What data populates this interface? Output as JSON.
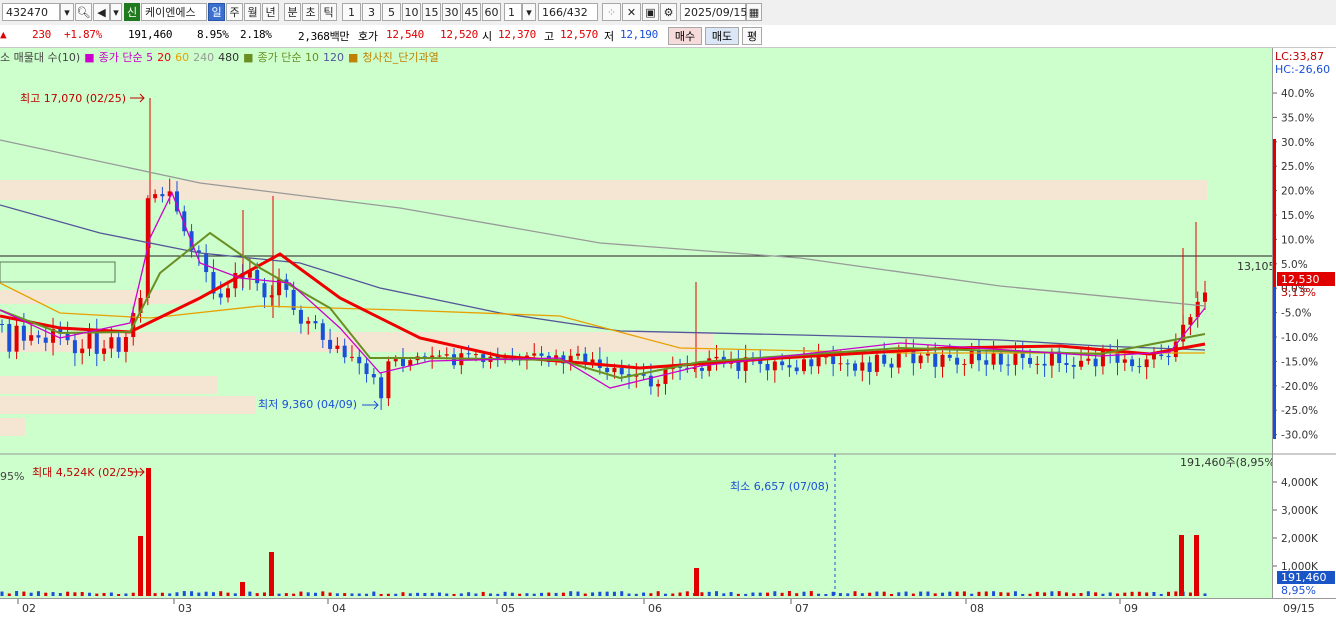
{
  "toolbar": {
    "code": "432470",
    "credit_badge": "신",
    "stock_name": "케이엔에스",
    "periods": [
      "일",
      "주",
      "월",
      "년",
      "분",
      "초",
      "틱"
    ],
    "selected_period": "일",
    "minute_values": [
      "1",
      "3",
      "5",
      "10",
      "15",
      "30",
      "45",
      "60"
    ],
    "count_value": "1",
    "bars_shown": "166",
    "bars_total": "/432",
    "date": "2025/09/15"
  },
  "infobar": {
    "change_arrow": "▲",
    "change": "230",
    "change_pct": "+1.87%",
    "volume": "191,460",
    "volume_pct": "8.95%",
    "turnover_pct": "2.18%",
    "amount": "2,368백만",
    "quote_label": "호가",
    "ask": "12,540",
    "bid": "12,520",
    "open_label": "시",
    "open": "12,370",
    "high_label": "고",
    "high": "12,570",
    "low_label": "저",
    "low": "12,190",
    "buy_label": "매수",
    "sell_label": "매도",
    "avg_label": "평"
  },
  "legend": {
    "item1": "소 매물대 수(10)",
    "item2": "종가 단순 5",
    "item2_vals": [
      "20",
      "60",
      "240",
      "480"
    ],
    "item3": "종가 단순 10",
    "item3_vals": [
      "120"
    ],
    "item4": "청사진_단기과열"
  },
  "annotations": {
    "high_label": "최고 17,070 (02/25)",
    "low_label": "최저 9,360 (04/09)",
    "vol_max_label": "최대 4,524K (02/25)",
    "vol_min_label": "최소 6,657 (07/08)",
    "vol_max_prefix": "95%",
    "ref_price": "13,105",
    "vol_summary": "191,460주(8,95%)",
    "lc": "LC:33,87",
    "hc": "HC:-26,60"
  },
  "price_tag": {
    "price": "12,530",
    "pct": "3,13%",
    "vol": "191,460",
    "vol_pct": "8,95%"
  },
  "right_axis": {
    "pct_labels": [
      "40.0%",
      "35.0%",
      "30.0%",
      "25.0%",
      "20.0%",
      "15.0%",
      "10.0%",
      "5.0%",
      "0.0%",
      "-5.0%",
      "-10.0%",
      "-15.0%",
      "-20.0%",
      "-25.0%",
      "-30.0%"
    ],
    "vol_labels": [
      "4,000K",
      "3,000K",
      "2,000K",
      "1,000K"
    ]
  },
  "x_axis": {
    "months": [
      "02",
      "03",
      "04",
      "05",
      "06",
      "07",
      "08",
      "09"
    ],
    "end_date": "09/15"
  },
  "colors": {
    "chart_bg": "#ccffcc",
    "up": "#e00000",
    "down": "#1a4fd8",
    "ma5": "#cc00cc",
    "ma20": "#ee0000",
    "ma60": "#ffa500",
    "ma120": "#555599",
    "ma240": "#999999",
    "ma10": "#6b8e23",
    "band": "#f5e6d3"
  }
}
